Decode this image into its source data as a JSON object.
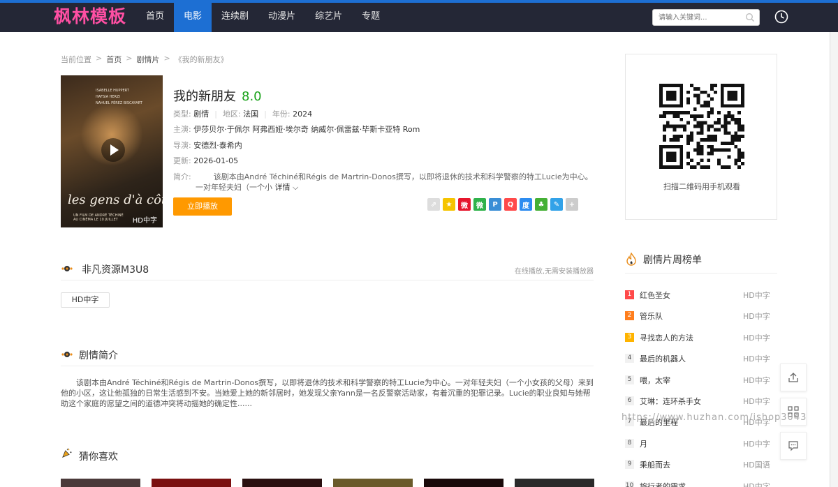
{
  "header": {
    "logo": "枫林模板",
    "nav": [
      {
        "label": "首页",
        "active": false
      },
      {
        "label": "电影",
        "active": true
      },
      {
        "label": "连续剧",
        "active": false
      },
      {
        "label": "动漫片",
        "active": false
      },
      {
        "label": "综艺片",
        "active": false
      },
      {
        "label": "专题",
        "active": false
      }
    ],
    "search_placeholder": "请输入关键词..."
  },
  "breadcrumb": {
    "label": "当前位置",
    "home": "首页",
    "category": "剧情片",
    "current": "《我的新朋友》"
  },
  "poster": {
    "badge": "HD中字",
    "title_text": "les gens d'à côté",
    "credits": [
      "ISABELLE HUPPERT",
      "HAFSIA HERZI",
      "NAHUEL PÉREZ BISCAYART"
    ],
    "director_line": "UN FILM DE ANDRÉ TÉCHINÉ",
    "release": "AU CINÉMA LE 10 JUILLET"
  },
  "movie": {
    "title": "我的新朋友",
    "score": "8.0",
    "type_label": "类型:",
    "type": "剧情",
    "region_label": "地区:",
    "region": "法国",
    "year_label": "年份:",
    "year": "2024",
    "cast_label": "主演:",
    "cast": "伊莎贝尔·于佩尔 阿弗西娅·埃尔奇 纳威尔·佩雷兹·毕斯卡亚特 Rom",
    "director_label": "导演:",
    "director": "安德烈·泰希内",
    "update_label": "更新:",
    "update": "2026-01-05",
    "synopsis_label": "简介:",
    "synopsis_short_1": "该剧本由André Téchiné和Régis de Martrin-Donos撰写，以即将退休的技术和科学警察的特工Lucie为中心。",
    "synopsis_short_2": "一对年轻夫妇（一个小",
    "more": "详情 ⌵",
    "play_button": "立即播放"
  },
  "share_icons": [
    {
      "name": "share-more",
      "color": "#dddddd",
      "glyph": "⇗"
    },
    {
      "name": "qzone",
      "color": "#f5c400",
      "glyph": "★"
    },
    {
      "name": "weibo",
      "color": "#e6162d",
      "glyph": "微"
    },
    {
      "name": "wechat",
      "color": "#2fb24b",
      "glyph": "微"
    },
    {
      "name": "tencent-weibo",
      "color": "#3a8ed6",
      "glyph": "P"
    },
    {
      "name": "qq",
      "color": "#ff4a4a",
      "glyph": "Q"
    },
    {
      "name": "baidu",
      "color": "#2d8cf0",
      "glyph": "度"
    },
    {
      "name": "renren",
      "color": "#45b035",
      "glyph": "♣"
    },
    {
      "name": "douban",
      "color": "#32a2e8",
      "glyph": "✎"
    },
    {
      "name": "plus",
      "color": "#cccccc",
      "glyph": "+"
    }
  ],
  "qr": {
    "caption": "扫描二维码用手机观看"
  },
  "source": {
    "title": "非凡资源M3U8",
    "note": "在线播放,无需安装播放器",
    "episodes": [
      "HD中字"
    ]
  },
  "intro": {
    "title": "剧情简介",
    "text": "该剧本由André Téchiné和Régis de Martrin-Donos撰写，以即将退休的技术和科学警察的特工Lucie为中心。一对年轻夫妇（一个小女孩的父母）来到他的小区，这让他孤独的日常生活感到不安。当她爱上她的新邻居时，她发现父亲Yann是一名反警察活动家，有着沉重的犯罪记录。Lucie的职业良知与她帮助这个家庭的愿望之间的道德冲突将动摇她的确定性......"
  },
  "recommend": {
    "title": "猜你喜欢"
  },
  "rank": {
    "title": "剧情片周榜单",
    "items": [
      {
        "num": "1",
        "name": "红色圣女",
        "tag": "HD中字"
      },
      {
        "num": "2",
        "name": "管乐队",
        "tag": "HD中字"
      },
      {
        "num": "3",
        "name": "寻找恋人的方法",
        "tag": "HD中字"
      },
      {
        "num": "4",
        "name": "最后的机器人",
        "tag": "HD中字"
      },
      {
        "num": "5",
        "name": "喂，太宰",
        "tag": "HD中字"
      },
      {
        "num": "6",
        "name": "艾琳：连环杀手女",
        "tag": "HD中字"
      },
      {
        "num": "7",
        "name": "最后的里程",
        "tag": "HD中字"
      },
      {
        "num": "8",
        "name": "月",
        "tag": "HD中字"
      },
      {
        "num": "9",
        "name": "乘船而去",
        "tag": "HD国语"
      },
      {
        "num": "10",
        "name": "旅行者的需求",
        "tag": "HD中字"
      }
    ]
  },
  "watermark": "https://www.huzhan.com/ishop3043",
  "colors": {
    "nav_bg": "#242736",
    "accent": "#1d6fd3",
    "score": "#1aa21a",
    "play_button": "#ff9900",
    "logo": "#ff4fa3"
  }
}
